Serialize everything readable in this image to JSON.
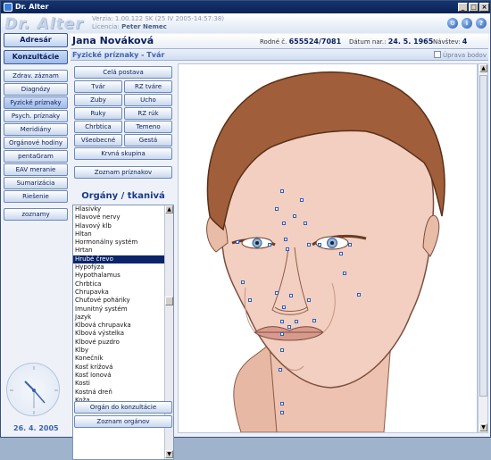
{
  "app": {
    "title": "Dr. Alter",
    "logo": "Dr. Alter"
  },
  "version": {
    "line1": "Verzia: 1.00.122 SK (25 IV 2005-14:57:38)",
    "license_label": "Licencia:",
    "license_name": "Peter Nemec"
  },
  "nav": {
    "adresar": "Adresár",
    "konzultacie": "Konzultácie",
    "items": [
      "Zdrav. záznam",
      "Diagnózy",
      "Fyzické príznaky",
      "Psych. príznaky",
      "Meridiány",
      "Orgánové hodiny",
      "pentaGram",
      "EAV meranie",
      "Sumarizácia",
      "Riešenie"
    ],
    "zoznamy": "zoznamy"
  },
  "clock_date": "26. 4. 2005",
  "patient": {
    "name": "Jana Nováková",
    "rc_label": "Rodné č.",
    "rc": "655524/7081",
    "dob_label": "Dátum nar.:",
    "dob": "24. 5. 1965",
    "visits_label": "Návštev:",
    "visits": "4"
  },
  "section": {
    "title": "Fyzické príznaky - Tvár",
    "edit_points": "Úprava bodov"
  },
  "body_buttons": {
    "cela": "Celá postava",
    "tvar": "Tvár",
    "rz_tvare": "RZ tváre",
    "zuby": "Zuby",
    "ucho": "Ucho",
    "ruky": "Ruky",
    "rz_ruk": "RZ rúk",
    "chrbtica": "Chrbtica",
    "temeno": "Temeno",
    "vseobecne": "Všeobecné",
    "gesta": "Gestá",
    "krvna": "Krvná skupina",
    "zoznam_priznakov": "Zoznam príznakov"
  },
  "organ_title": "Orgány / tkanivá",
  "organs": [
    "Hlasivky",
    "Hlavové nervy",
    "Hlavový kĺb",
    "Hltan",
    "Hormonálny systém",
    "Hrtan",
    "Hrubé črevo",
    "Hypofýza",
    "Hypothalamus",
    "Chrbtica",
    "Chrupavka",
    "Chuťové poháriky",
    "Imunitný systém",
    "Jazyk",
    "Kĺbová chrupavka",
    "Kĺbová výstelka",
    "Kĺbové puzdro",
    "Kĺby",
    "Konečník",
    "Kosť krížová",
    "Kosť lonová",
    "Kosti",
    "Kostná dreň",
    "Koža"
  ],
  "selected_organ": "Hrubé črevo",
  "bottom_buttons": {
    "organ_do_konzultacie": "Orgán do konzultácie",
    "zoznam_organov": "Zoznam orgánov"
  },
  "colors": {
    "title_bar": "#0a2258",
    "accent": "#3c61b0",
    "skin": "#f2cfc0",
    "hair": "#a05f3a"
  }
}
